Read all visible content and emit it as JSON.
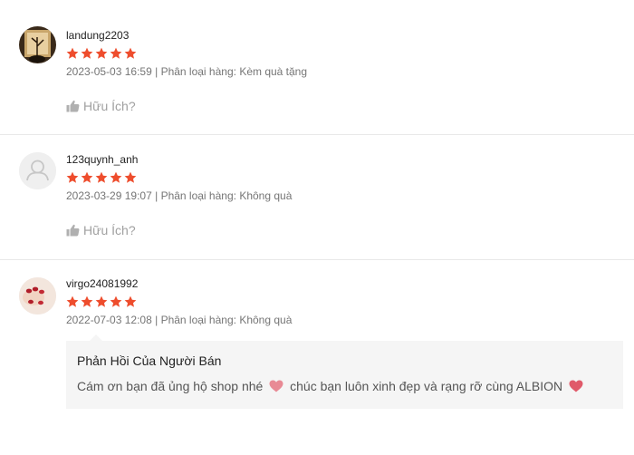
{
  "reviews": [
    {
      "username": "landung2203",
      "rating": 5,
      "datetime": "2023-05-03 16:59",
      "separator": "|",
      "variation_label": "Phân loại hàng:",
      "variation_value": "Kèm quà tặng",
      "helpful_label": "Hữu Ích?"
    },
    {
      "username": "123quynh_anh",
      "rating": 5,
      "datetime": "2023-03-29 19:07",
      "separator": "|",
      "variation_label": "Phân loại hàng:",
      "variation_value": "Không quà",
      "helpful_label": "Hữu Ích?"
    },
    {
      "username": "virgo24081992",
      "rating": 5,
      "datetime": "2022-07-03 12:08",
      "separator": "|",
      "variation_label": "Phân loại hàng:",
      "variation_value": "Không quà",
      "seller_reply": {
        "title": "Phản Hồi Của Người Bán",
        "text_part1": "Cám ơn bạn đã ủng hộ shop nhé",
        "text_part2": "chúc bạn luôn xinh đẹp và rạng rỡ cùng ALBION"
      }
    }
  ],
  "colors": {
    "star": "#ee4d2d",
    "heart": "#e05a6a",
    "muted_text": "#757575",
    "reply_bg": "#f5f5f5"
  },
  "icons": {
    "star": "star-icon",
    "thumbs_up": "thumbs-up-icon",
    "heart": "heart-icon",
    "default_avatar": "user-placeholder-icon"
  }
}
